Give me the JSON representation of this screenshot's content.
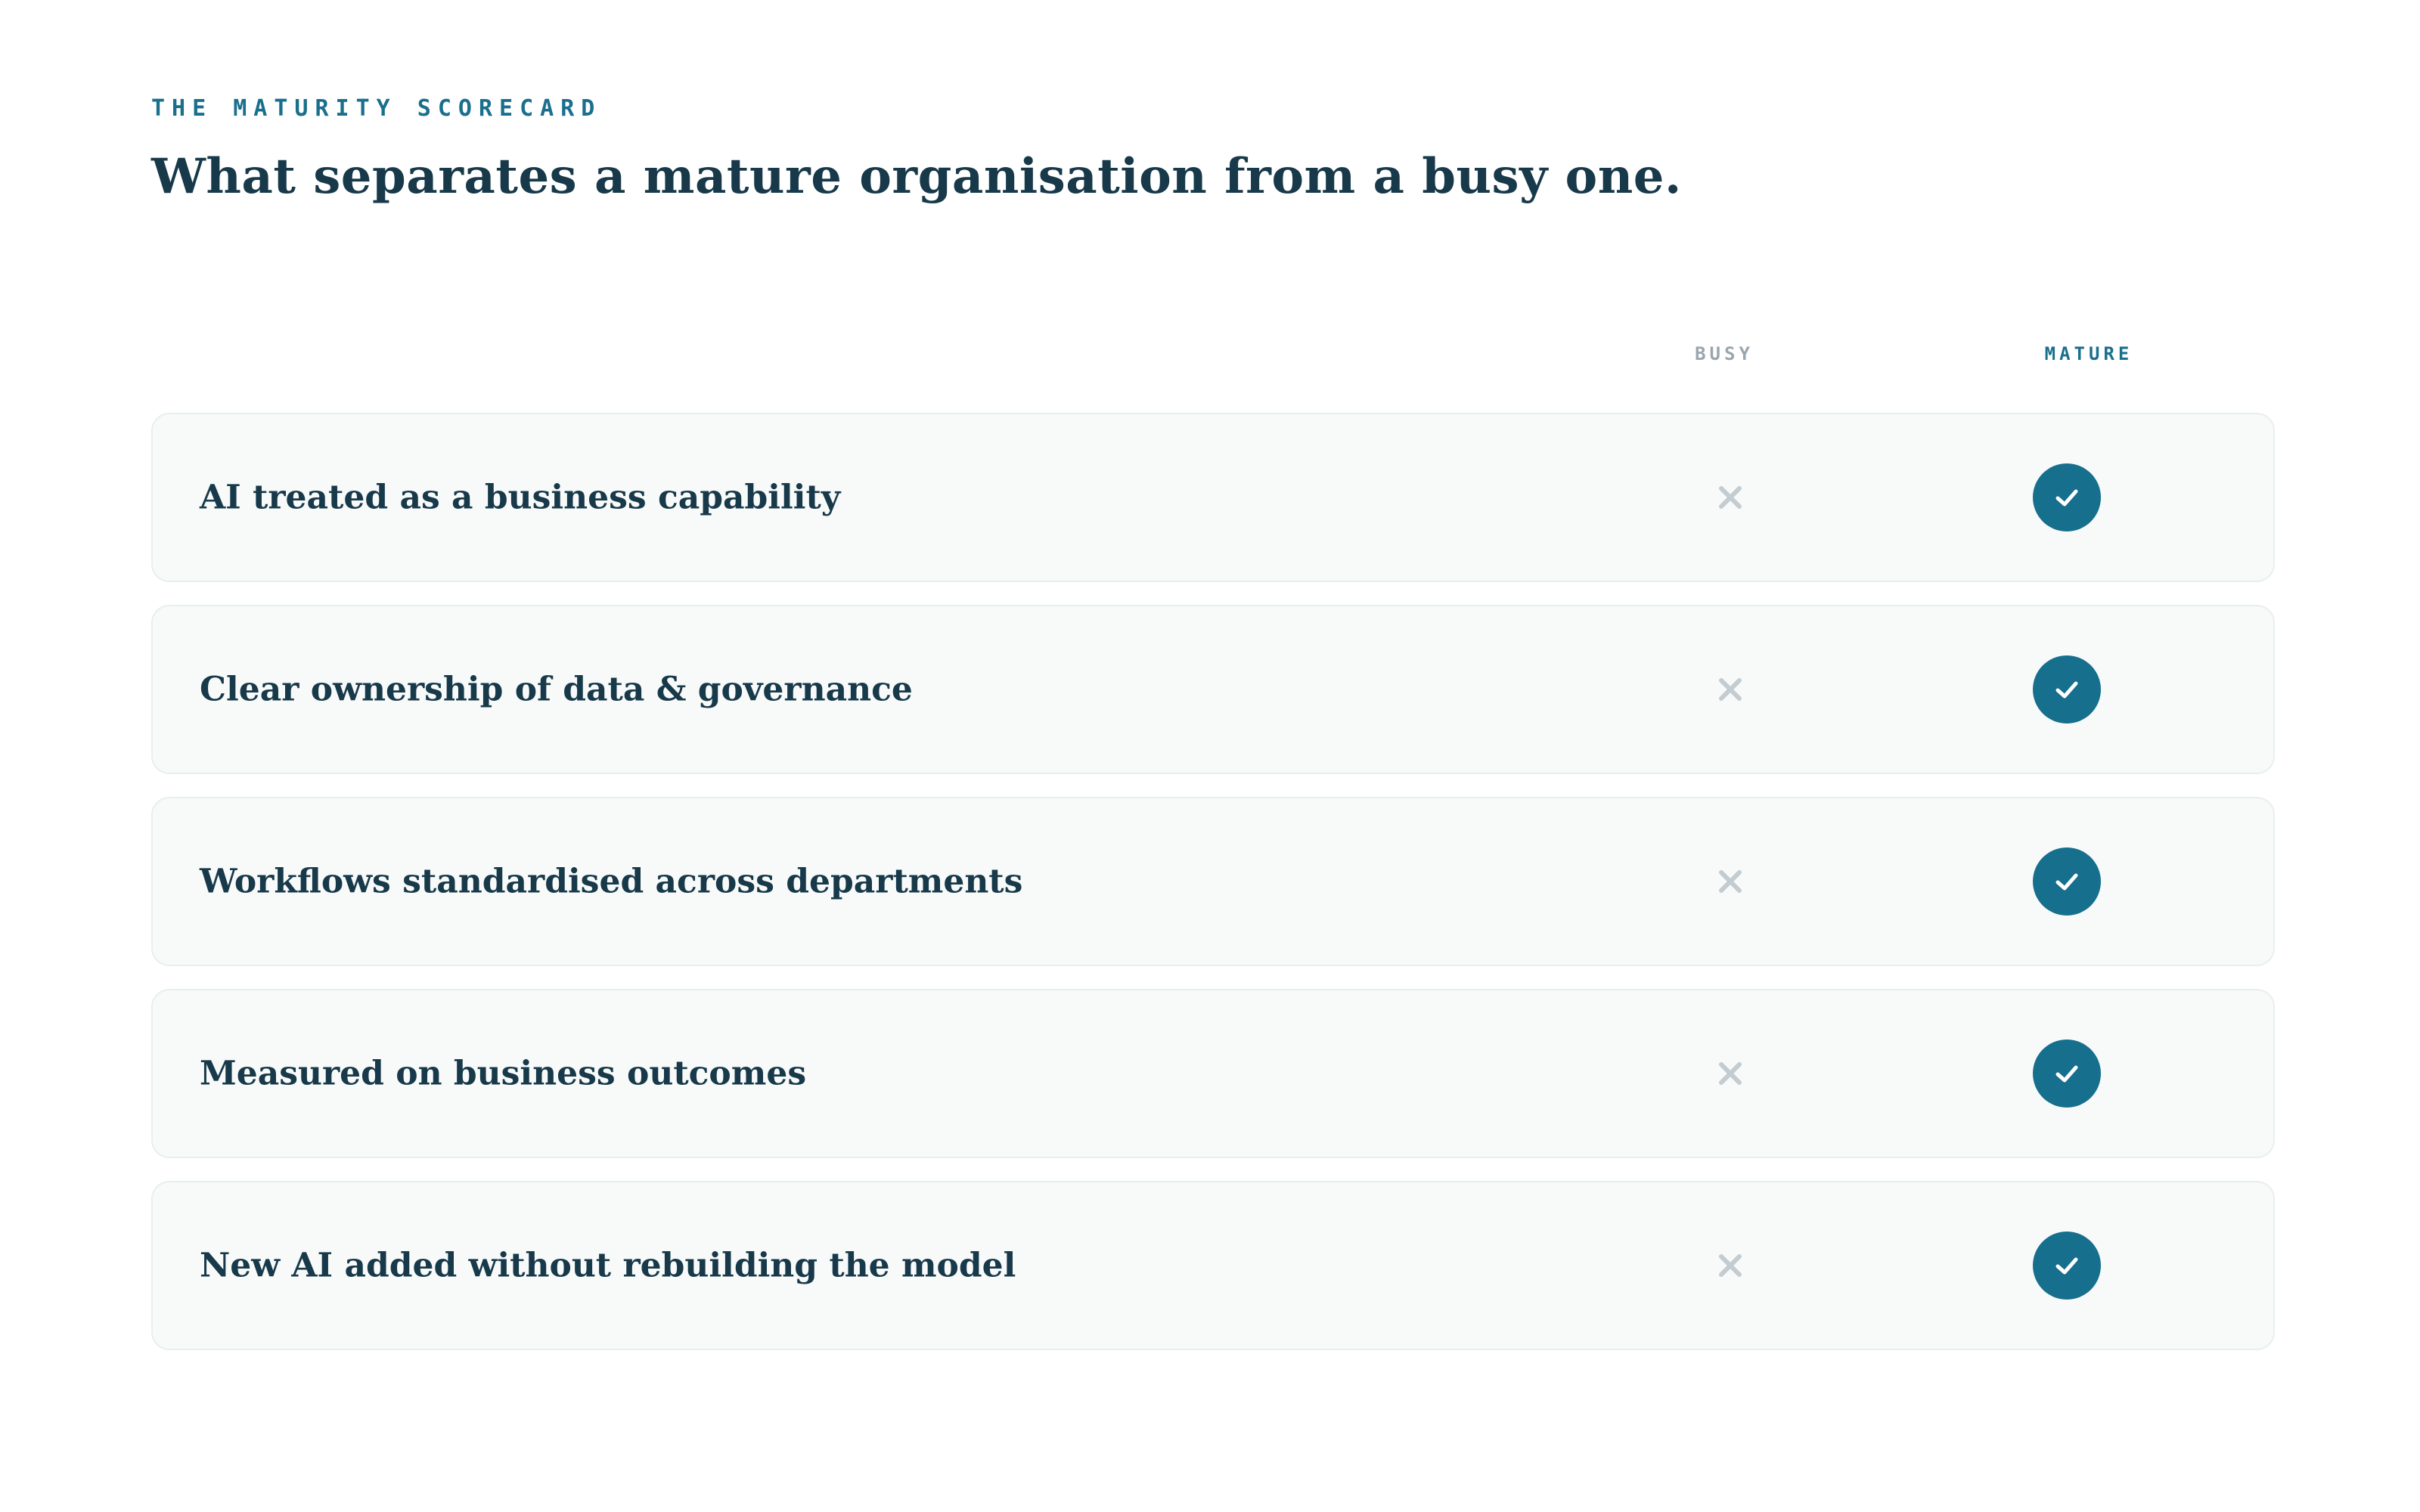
{
  "header": {
    "eyebrow": "THE MATURITY SCORECARD",
    "title": "What separates a mature organisation from a busy one."
  },
  "columns": {
    "busy": "BUSY",
    "mature": "MATURE"
  },
  "rows": [
    {
      "label": "AI treated as a business capability",
      "busy": "x-icon",
      "mature": "check-icon"
    },
    {
      "label": "Clear ownership of data & governance",
      "busy": "x-icon",
      "mature": "check-icon"
    },
    {
      "label": "Workflows standardised across departments",
      "busy": "x-icon",
      "mature": "check-icon"
    },
    {
      "label": "Measured on business outcomes",
      "busy": "x-icon",
      "mature": "check-icon"
    },
    {
      "label": "New AI added without rebuilding the model",
      "busy": "x-icon",
      "mature": "check-icon"
    }
  ],
  "colors": {
    "accent": "#156f8d",
    "text": "#17394a",
    "muted": "#9aa6ad",
    "row_bg": "#f8fafa",
    "row_border": "#e8eeef"
  }
}
